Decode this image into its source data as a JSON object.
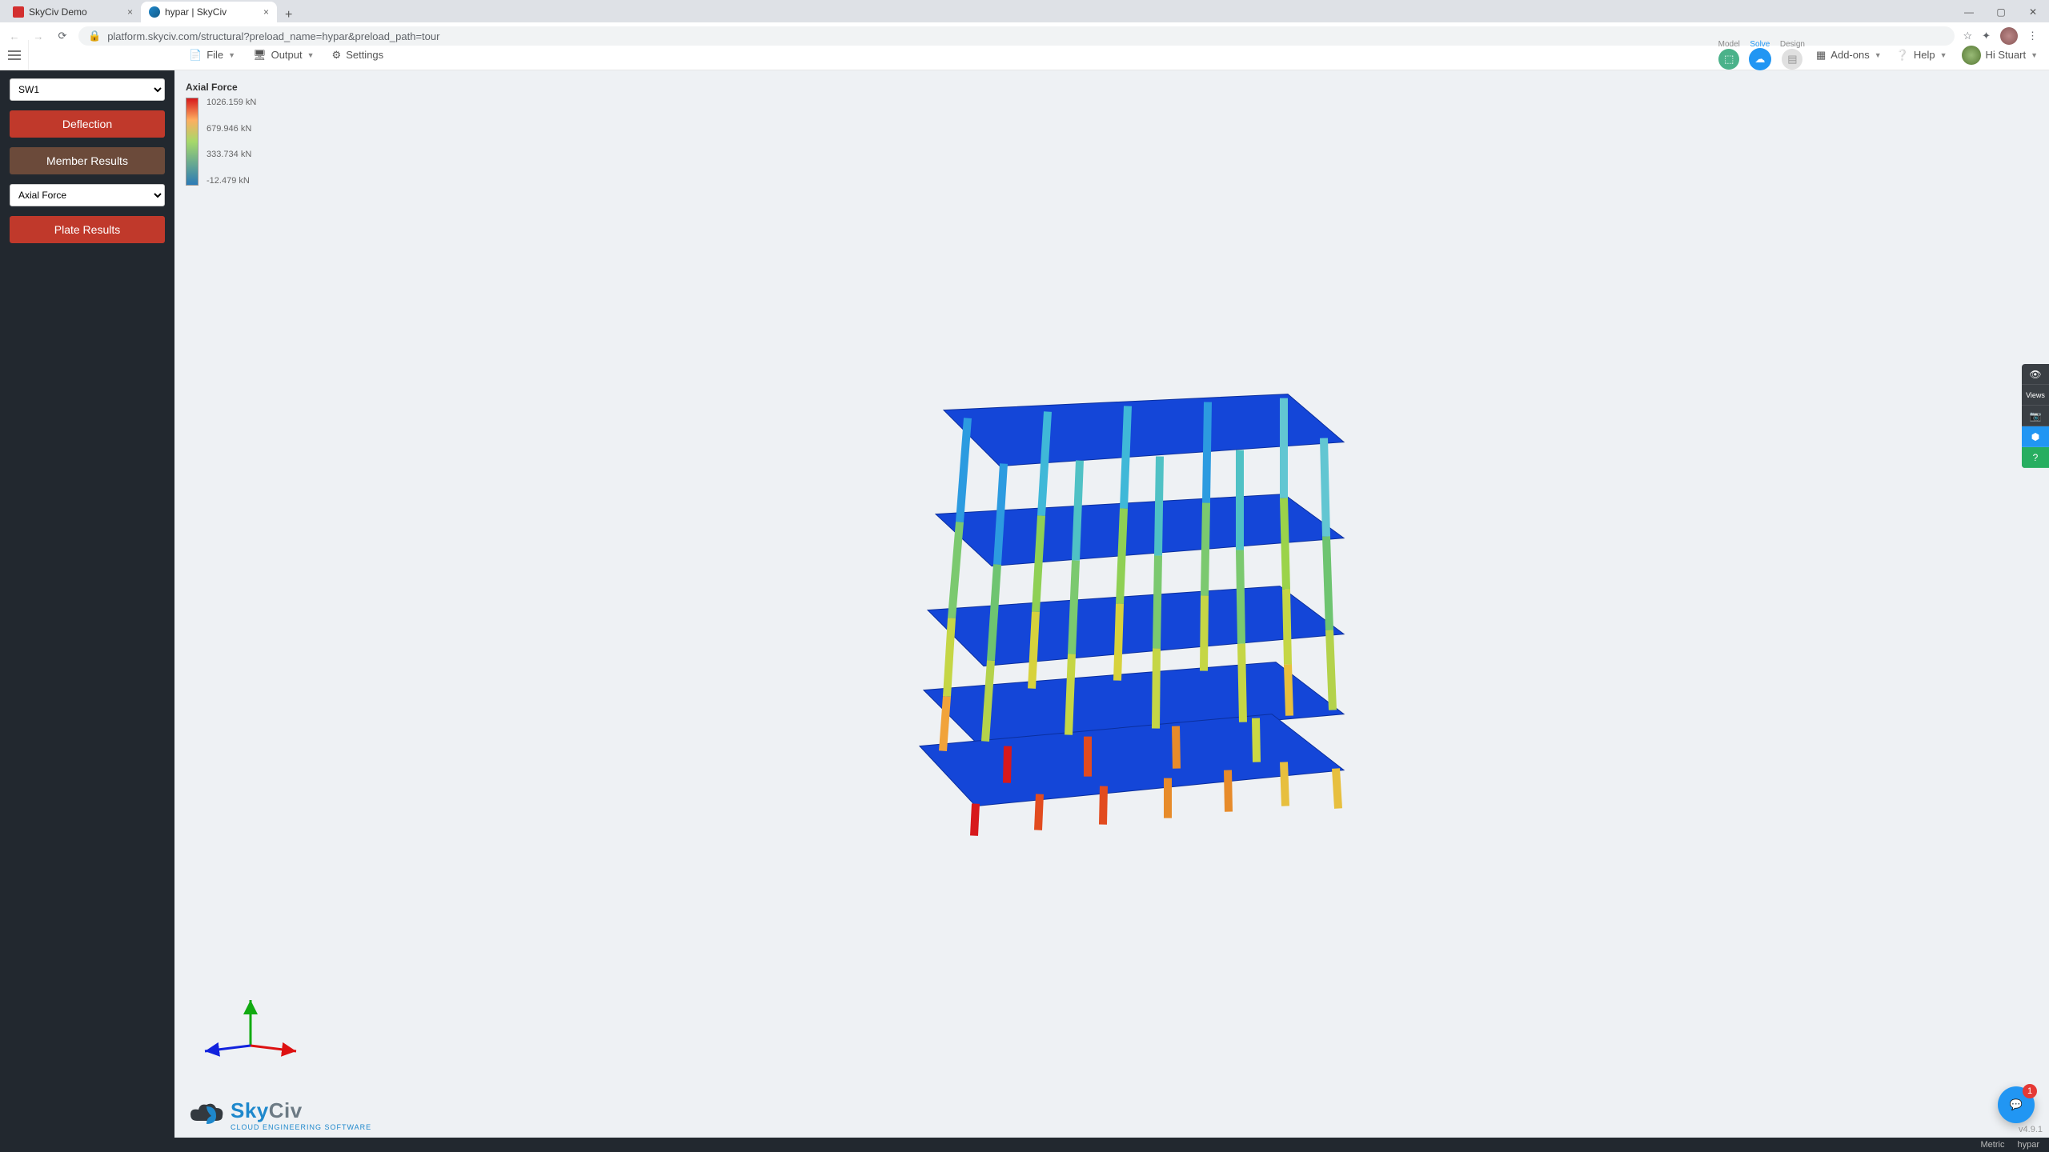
{
  "browser": {
    "tabs": [
      {
        "title": "SkyCiv Demo",
        "active": false
      },
      {
        "title": "hypar | SkyCiv",
        "active": true
      }
    ],
    "url": "platform.skyciv.com/structural?preload_name=hypar&preload_path=tour"
  },
  "topbar": {
    "menus": {
      "file": "File",
      "output": "Output",
      "settings": "Settings"
    },
    "pipeline": {
      "model": "Model",
      "solve": "Solve",
      "design": "Design"
    },
    "right": {
      "addons": "Add-ons",
      "help": "Help",
      "user_greeting": "Hi Stuart"
    }
  },
  "sidebar": {
    "load_case_selected": "SW1",
    "buttons": {
      "deflection": "Deflection",
      "member_results": "Member Results",
      "plate_results": "Plate Results"
    },
    "result_type_selected": "Axial Force"
  },
  "legend": {
    "title": "Axial Force",
    "labels": [
      "1026.159 kN",
      "679.946 kN",
      "333.734 kN",
      "-12.479 kN"
    ]
  },
  "logo": {
    "brand": "SkyCiv",
    "tagline": "CLOUD ENGINEERING SOFTWARE"
  },
  "float_tools": {
    "views_label": "Views"
  },
  "chat": {
    "unread": "1"
  },
  "status": {
    "units": "Metric",
    "project": "hypar",
    "version": "v4.9.1"
  }
}
